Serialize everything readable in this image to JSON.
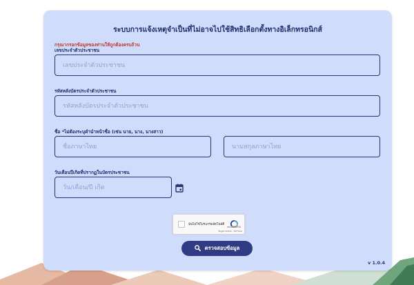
{
  "colors": {
    "card_background": "#cfdcfb",
    "heading_text": "#1f2d6e",
    "required_note": "#c0392b",
    "input_border": "#2a3370",
    "placeholder": "#96a2c6",
    "button_background": "#2f3c84"
  },
  "form": {
    "title": "ระบบการแจ้งเหตุจำเป็นที่ไม่อาจไปใช้สิทธิเลือกตั้งทางอิเล็กทรอนิกส์",
    "instruction": "กรุณากรอกข้อมูลของท่านให้ถูกต้องครบถ้วน",
    "citizen_id": {
      "label": "เลขประจำตัวประชาชน",
      "value": "",
      "placeholder": "เลขประจำตัวประชาชน"
    },
    "laser_code": {
      "label": "รหัสหลังบัตรประจำตัวประชาชน",
      "value": "",
      "placeholder": "รหัสหลังบัตรประจำตัวประชาชน"
    },
    "name": {
      "label": "ชื่อ *ไม่ต้องระบุคำนำหน้าชื่อ (เช่น นาย, นาง, นางสาว)",
      "first_name": {
        "value": "",
        "placeholder": "ชื่อภาษาไทย"
      },
      "last_name": {
        "value": "",
        "placeholder": "นามสกุลภาษาไทย"
      }
    },
    "birth_date": {
      "label": "วันเดือนปีเกิดที่ปรากฏในบัตรประชาชน",
      "value": "",
      "placeholder": "วัน/เดือน/ปี เกิด",
      "icon": "calendar-icon"
    },
    "captcha": {
      "checkbox_label": "ฉันไม่ใช่โปรแกรมอัตโนมัติ",
      "brand": "reCAPTCHA",
      "terms": "ข้อมูลส่วนบุคคล - ข้อกำหนด",
      "checked": false
    },
    "submit": {
      "label": "ตรวจสอบข้อมูล",
      "icon": "search-icon"
    }
  },
  "footer": {
    "version": "v 1.0.4"
  }
}
